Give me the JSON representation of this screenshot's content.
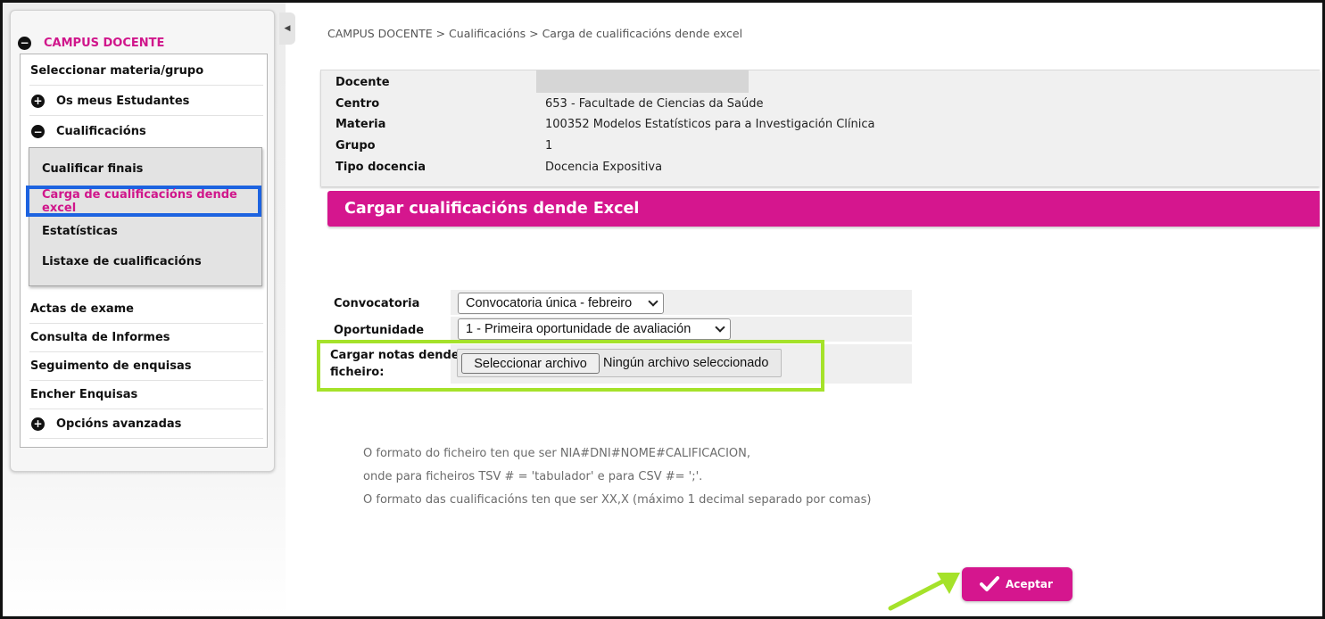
{
  "sidebar": {
    "header": "CAMPUS DOCENTE",
    "header_icon": "minus-circle-icon",
    "items": [
      {
        "label": "Seleccionar materia/grupo"
      },
      {
        "label": "Os meus Estudantes",
        "icon": "plus-circle-icon"
      },
      {
        "label": "Cualificacións",
        "icon": "minus-circle-icon"
      }
    ],
    "sub_items": [
      {
        "label": "Cualificar finais"
      },
      {
        "label": "Carga de cualificacións dende excel"
      },
      {
        "label": "Estatísticas"
      },
      {
        "label": "Listaxe de cualificacións"
      }
    ],
    "items_after": [
      {
        "label": "Actas de exame"
      },
      {
        "label": "Consulta de Informes"
      },
      {
        "label": "Seguimento de enquisas"
      },
      {
        "label": "Encher Enquisas"
      },
      {
        "label": "Opcións avanzadas",
        "icon": "plus-circle-icon"
      }
    ],
    "collapse_icon": "chevron-left-icon"
  },
  "breadcrumb": "CAMPUS DOCENTE > Cualificacións > Carga de cualificacións dende excel",
  "info": {
    "rows": [
      {
        "label": "Docente",
        "value": ""
      },
      {
        "label": "Centro",
        "value": "653 -  Facultade de Ciencias da Saúde"
      },
      {
        "label": "Materia",
        "value": "100352  Modelos Estatísticos para a Investigación Clínica"
      },
      {
        "label": "Grupo",
        "value": "1"
      },
      {
        "label": "Tipo docencia",
        "value": "Docencia Expositiva"
      }
    ]
  },
  "section_title": "Cargar cualificacións dende Excel",
  "form": {
    "convocatoria_label": "Convocatoria",
    "convocatoria_value": "Convocatoria única - febreiro",
    "oportunidade_label": "Oportunidade",
    "oportunidade_value": "1 - Primeira oportunidade de avaliación",
    "file_label_1": "Cargar notas dende",
    "file_label_2": "ficheiro:",
    "file_button": "Seleccionar archivo",
    "file_status": "Ningún archivo seleccionado"
  },
  "help": [
    "O formato do ficheiro ten que ser NIA#DNI#NOME#CALIFICACION,",
    "onde para ficheiros TSV # = 'tabulador' e para CSV #= ';'.",
    "O formato das cualificacións ten que ser XX,X (máximo 1 decimal separado por comas)"
  ],
  "accept_button": "Aceptar",
  "colors": {
    "accent": "#d5168e",
    "highlight_blue": "#1d63e0",
    "highlight_green": "#a5e22a"
  }
}
